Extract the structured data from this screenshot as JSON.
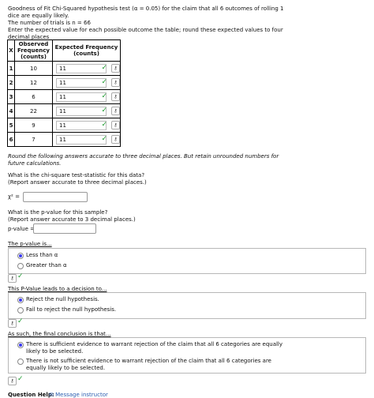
{
  "question": {
    "line1": "Goodness of Fit Chi-Squared hypothesis test (α = 0.05) for the claim that all 6 outcomes of rolling 1",
    "line2": "dice are equally likely.",
    "line3": "The number of trials is n = 66",
    "line4": "Enter the expected value for each possible outcome the table; round these expected values to four",
    "line5": "decimal places"
  },
  "table": {
    "headers": {
      "x": "X",
      "observed": "Observed Frequency (counts)",
      "expected": "Expected Frequency (counts)"
    },
    "rows": [
      {
        "x": "1",
        "observed": "10",
        "expected": "11"
      },
      {
        "x": "2",
        "observed": "12",
        "expected": "11"
      },
      {
        "x": "3",
        "observed": "6",
        "expected": "11"
      },
      {
        "x": "4",
        "observed": "22",
        "expected": "11"
      },
      {
        "x": "5",
        "observed": "9",
        "expected": "11"
      },
      {
        "x": "6",
        "observed": "7",
        "expected": "11"
      }
    ]
  },
  "round_note": {
    "line1": "Round the following answers accurate to three decimal places. But retain unrounded numbers for",
    "line2": "future calculations."
  },
  "chi_section": {
    "line1": "What is the chi-square test-statistic for this data?",
    "line2": "(Report answer accurate to three decimal places.)",
    "label": "χ² =",
    "value": ""
  },
  "pvalue_section": {
    "line1": "What is the p-value for this sample?",
    "line2": "(Report answer accurate to 3 decimal places.)",
    "label": "p-value =",
    "value": ""
  },
  "q_pvalue": {
    "label": "The p-value is...",
    "options": [
      "Less than α",
      "Greater than α"
    ],
    "selected": 0
  },
  "q_decision": {
    "label": "This P-Value leads to a decision to...",
    "options": [
      "Reject the null hypothesis.",
      "Fail to reject the null hypothesis."
    ],
    "selected": 0
  },
  "q_conclusion": {
    "label": "As such, the final conclusion is that...",
    "options": [
      [
        "There is sufficient evidence to warrant rejection of the claim that all 6 categories are equally",
        "likely to be selected."
      ],
      [
        "There is not sufficient evidence to warrant rejection of the claim that all 6 categories are",
        "equally likely to be selected."
      ]
    ],
    "selected": 0
  },
  "footer": {
    "help_label": "Question Help:",
    "message_label": "Message instructor"
  },
  "icons": {
    "key": "key-icon",
    "check": "check-icon",
    "mail": "mail-icon"
  },
  "colors": {
    "check": "#1c9b2e",
    "radio": "#3a3af0",
    "link": "#2a5db0"
  }
}
